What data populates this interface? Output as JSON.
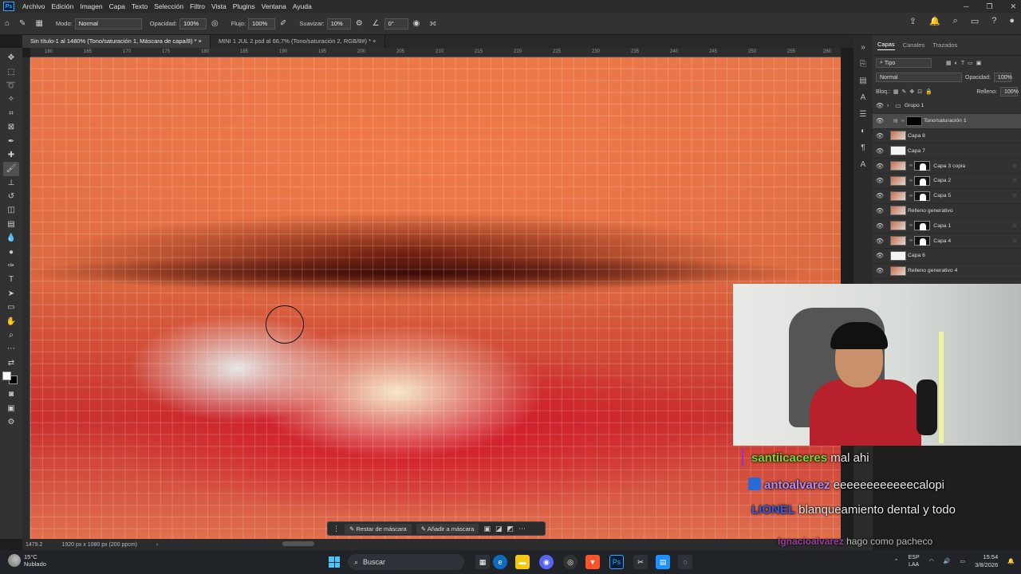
{
  "menu": [
    "Archivo",
    "Edición",
    "Imagen",
    "Capa",
    "Texto",
    "Selección",
    "Filtro",
    "Vista",
    "Plugins",
    "Ventana",
    "Ayuda"
  ],
  "app_logo": "Ps",
  "options": {
    "mode_label": "Modo:",
    "mode_value": "Normal",
    "opacity_label": "Opacidad:",
    "opacity_value": "100%",
    "flow_label": "Flujo:",
    "flow_value": "100%",
    "smooth_label": "Suavizar:",
    "smooth_value": "10%",
    "angle_value": "0°"
  },
  "tabs": [
    {
      "label": "Sin título-1 al 1480% (Tono/saturación 1, Máscara de capa/8) *"
    },
    {
      "label": "MINI 1 JUL 2.psd al 66,7% (Tono/saturación 2, RGB/8#) *"
    }
  ],
  "ruler_ticks": [
    "160",
    "165",
    "170",
    "175",
    "180",
    "185",
    "190",
    "195",
    "200",
    "205",
    "210",
    "215",
    "220",
    "225",
    "230",
    "235",
    "240",
    "245",
    "250",
    "255",
    "260"
  ],
  "context_bar": {
    "subtract": "Restar de máscara",
    "add": "Añadir a máscara"
  },
  "status": {
    "zoom": "1479.2",
    "doc_size": "1920 px x 1080 px (200 ppcm)"
  },
  "layers_panel": {
    "tabs": [
      "Capas",
      "Canales",
      "Trazados"
    ],
    "filter": "Tipo",
    "blend_mode": "Normal",
    "opacity_label": "Opacidad:",
    "opacity_value": "100%",
    "lock_label": "Bloq.:",
    "fill_label": "Relleno:",
    "fill_value": "100%",
    "layers": [
      {
        "name": "Grupo 1",
        "kind": "group"
      },
      {
        "name": "Tono/saturación 1",
        "kind": "adjust",
        "selected": true
      },
      {
        "name": "Capa 8",
        "kind": "pixel"
      },
      {
        "name": "Capa 7",
        "kind": "white"
      },
      {
        "name": "Capa 3 copia",
        "kind": "masked"
      },
      {
        "name": "Capa 2",
        "kind": "masked"
      },
      {
        "name": "Capa 5",
        "kind": "masked"
      },
      {
        "name": "Relleno generativo",
        "kind": "pixel"
      },
      {
        "name": "Capa 1",
        "kind": "masked"
      },
      {
        "name": "Capa 4",
        "kind": "masked"
      },
      {
        "name": "Capa 6",
        "kind": "white"
      },
      {
        "name": "Relleno generativo 4",
        "kind": "pixel"
      }
    ]
  },
  "chat": [
    {
      "user": "santiicaceres",
      "message": "mal ahi",
      "color": "#7ad629"
    },
    {
      "user": "antoalvarez",
      "message": "eeeeeeeeeeeecalopi",
      "color": "#b48cf0"
    },
    {
      "user": "LIONEL",
      "message": "blanqueamiento dental y todo",
      "color": "#3a5ad8"
    },
    {
      "user": "Ignacioalvarez",
      "message": "hago como pacheco",
      "color": "#c040c0"
    }
  ],
  "taskbar": {
    "temp": "15°C",
    "weather": "Nublado",
    "search": "Buscar",
    "lang": "ESP",
    "lang2": "LAA",
    "time": "15:54",
    "date": "3/8/2026"
  }
}
